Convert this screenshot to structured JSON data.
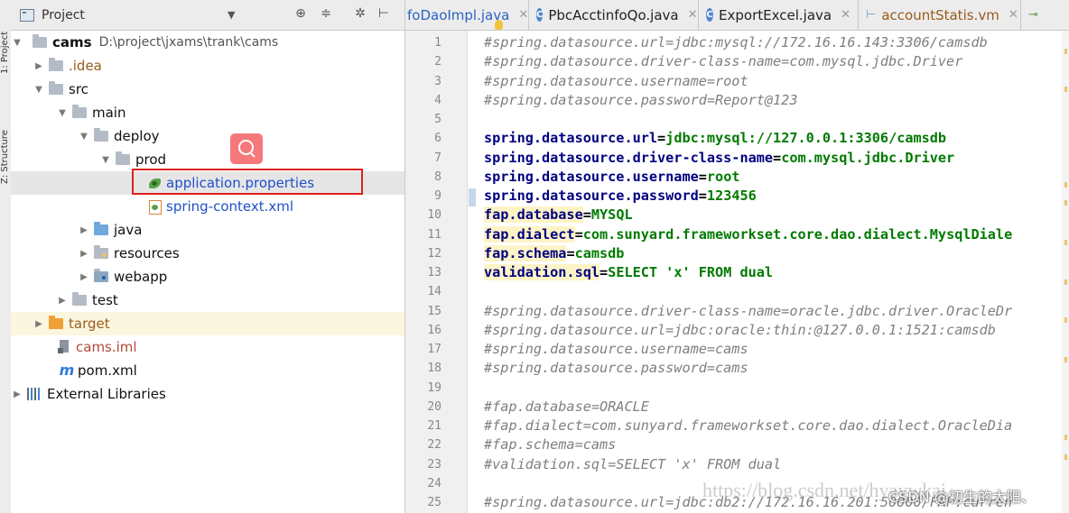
{
  "side_strip": {
    "tabs": [
      "1: Project",
      "Z: Structure"
    ]
  },
  "project_panel": {
    "title": "Project",
    "tree": [
      {
        "label": "cams",
        "path": "D:\\project\\jxams\\trank\\cams"
      },
      {
        "label": ".idea"
      },
      {
        "label": "src"
      },
      {
        "label": "main"
      },
      {
        "label": "deploy"
      },
      {
        "label": "prod"
      },
      {
        "label": "application.properties"
      },
      {
        "label": "spring-context.xml"
      },
      {
        "label": "java"
      },
      {
        "label": "resources"
      },
      {
        "label": "webapp"
      },
      {
        "label": "test"
      },
      {
        "label": "target"
      },
      {
        "label": "cams.iml"
      },
      {
        "label": "pom.xml"
      },
      {
        "label": "External Libraries"
      }
    ]
  },
  "tabs": [
    {
      "label": "foDaoImpl.java"
    },
    {
      "label": "PbcAcctinfoQo.java",
      "icon": "C"
    },
    {
      "label": "ExportExcel.java",
      "icon": "C"
    },
    {
      "label": "accountStatis.vm"
    }
  ],
  "editor": {
    "lines": [
      {
        "n": "1",
        "text": "#spring.datasource.url=jdbc:mysql://172.16.16.143:3306/camsdb"
      },
      {
        "n": "2",
        "text": "#spring.datasource.driver-class-name=com.mysql.jdbc.Driver"
      },
      {
        "n": "3",
        "text": "#spring.datasource.username=root"
      },
      {
        "n": "4",
        "text": "#spring.datasource.password=Report@123"
      },
      {
        "n": "5",
        "text": ""
      },
      {
        "n": "6",
        "key": "spring.datasource.url",
        "val": "jdbc:mysql://127.0.0.1:3306/camsdb"
      },
      {
        "n": "7",
        "key": "spring.datasource.driver-class-name",
        "val": "com.mysql.jdbc.Driver"
      },
      {
        "n": "8",
        "key": "spring.datasource.username",
        "val": "root"
      },
      {
        "n": "9",
        "key": "spring.datasource.password",
        "val": "123456"
      },
      {
        "n": "10",
        "key": "fap.database",
        "val": "MYSQL"
      },
      {
        "n": "11",
        "key": "fap.dialect",
        "val": "com.sunyard.frameworkset.core.dao.dialect.MysqlDiale"
      },
      {
        "n": "12",
        "key": "fap.schema",
        "val": "camsdb"
      },
      {
        "n": "13",
        "key": "validation.sql",
        "val": "SELECT 'x' FROM dual"
      },
      {
        "n": "14",
        "text": ""
      },
      {
        "n": "15",
        "text": "#spring.datasource.driver-class-name=oracle.jdbc.driver.OracleDr"
      },
      {
        "n": "16",
        "text": "#spring.datasource.url=jdbc:oracle:thin:@127.0.0.1:1521:camsdb"
      },
      {
        "n": "17",
        "text": "#spring.datasource.username=cams"
      },
      {
        "n": "18",
        "text": "#spring.datasource.password=cams"
      },
      {
        "n": "19",
        "text": ""
      },
      {
        "n": "20",
        "text": "#fap.database=ORACLE"
      },
      {
        "n": "21",
        "text": "#fap.dialect=com.sunyard.frameworkset.core.dao.dialect.OracleDia"
      },
      {
        "n": "22",
        "text": "#fap.schema=cams"
      },
      {
        "n": "23",
        "text": "#validation.sql=SELECT 'x' FROM dual"
      },
      {
        "n": "24",
        "text": ""
      },
      {
        "n": "25",
        "text": "#spring.datasource.url=jdbc:db2://172.16.16.201:50000/FAP:curren"
      }
    ]
  },
  "watermark": {
    "url": "https://blog.csdn.net/hyaywkai",
    "csdn": "CSDN @初生的太阳、"
  }
}
